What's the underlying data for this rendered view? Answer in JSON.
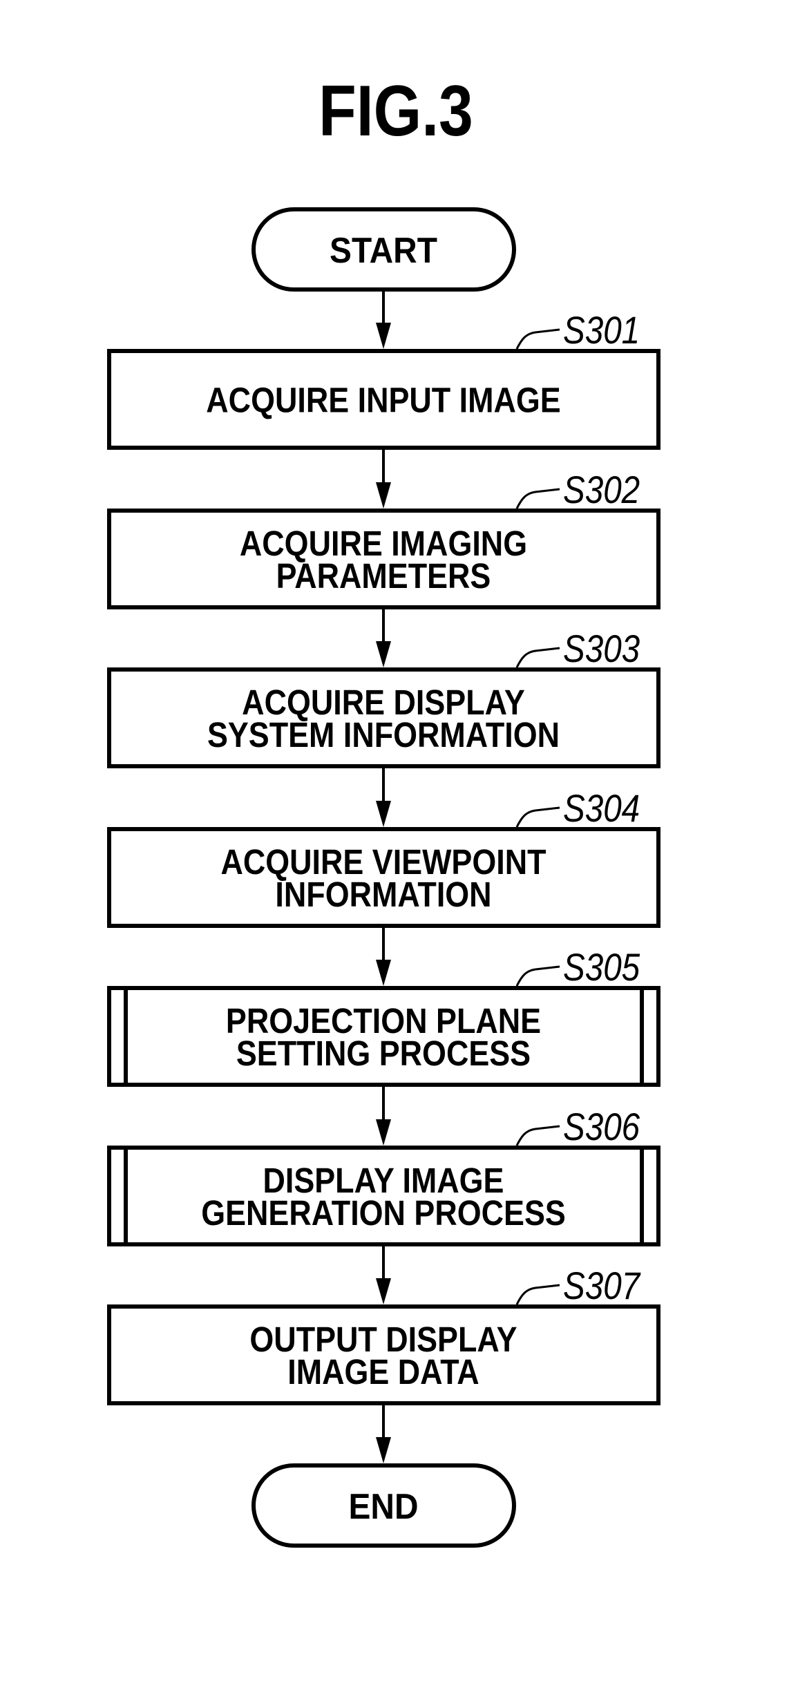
{
  "figure": {
    "title": "FIG.3",
    "ink_color": "#000000",
    "background_color": "#ffffff"
  },
  "flowchart": {
    "start": {
      "label": "START",
      "shape": "terminal"
    },
    "steps": [
      {
        "id": "S301",
        "label": "S301",
        "lines": [
          "ACQUIRE INPUT IMAGE"
        ],
        "shape": "process"
      },
      {
        "id": "S302",
        "label": "S302",
        "lines": [
          "ACQUIRE IMAGING",
          "PARAMETERS"
        ],
        "shape": "process"
      },
      {
        "id": "S303",
        "label": "S303",
        "lines": [
          "ACQUIRE DISPLAY",
          "SYSTEM INFORMATION"
        ],
        "shape": "process"
      },
      {
        "id": "S304",
        "label": "S304",
        "lines": [
          "ACQUIRE VIEWPOINT",
          "INFORMATION"
        ],
        "shape": "process"
      },
      {
        "id": "S305",
        "label": "S305",
        "lines": [
          "PROJECTION PLANE",
          "SETTING PROCESS"
        ],
        "shape": "predefined-process"
      },
      {
        "id": "S306",
        "label": "S306",
        "lines": [
          "DISPLAY IMAGE",
          "GENERATION PROCESS"
        ],
        "shape": "predefined-process"
      },
      {
        "id": "S307",
        "label": "S307",
        "lines": [
          "OUTPUT DISPLAY",
          "IMAGE DATA"
        ],
        "shape": "process"
      }
    ],
    "end": {
      "label": "END",
      "shape": "terminal"
    }
  }
}
